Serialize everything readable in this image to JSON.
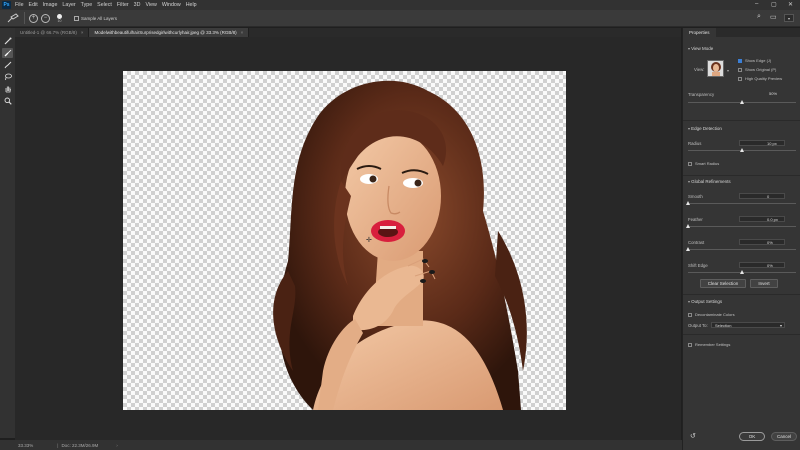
{
  "menu": [
    "File",
    "Edit",
    "Image",
    "Layer",
    "Type",
    "Select",
    "Filter",
    "3D",
    "View",
    "Window",
    "Help"
  ],
  "options": {
    "brush_size": "10",
    "sample_all_layers": "Sample All Layers"
  },
  "tabs": [
    {
      "label": "Untitled-1 @ 66.7% (RGB/8)",
      "active": false
    },
    {
      "label": "ModelwithbeautifulhairSurprisedgirlwithcurlyhair.jpeg @ 33.3% (RGB/8)",
      "active": true
    }
  ],
  "status": {
    "zoom": "33.33%",
    "doc": "Doc: 22.3M/26.9M"
  },
  "panel": {
    "tab": "Properties",
    "view_mode": {
      "title": "View Mode",
      "view_label": "View:",
      "show_edge": "Show Edge (J)",
      "show_original": "Show Original (P)",
      "high_quality_preview": "High Quality Preview"
    },
    "transparency": {
      "label": "Transparency",
      "value": "50%",
      "level": 0.5
    },
    "edge_detection": {
      "title": "Edge Detection",
      "radius_label": "Radius",
      "radius_value": "10 px",
      "radius_level": 0.5,
      "smart_radius": "Smart Radius"
    },
    "global_refinements": {
      "title": "Global Refinements",
      "smooth_label": "Smooth",
      "smooth_value": "0",
      "feather_label": "Feather",
      "feather_value": "0.0 px",
      "contrast_label": "Contrast",
      "contrast_value": "0%",
      "shift_edge_label": "Shift Edge",
      "shift_edge_value": "0%",
      "shift_level": 0.5,
      "clear_selection": "Clear Selection",
      "invert": "Invert"
    },
    "output_settings": {
      "title": "Output Settings",
      "decontaminate": "Decontaminate Colors",
      "output_to_label": "Output To:",
      "output_to_value": "Selection",
      "remember": "Remember Settings"
    },
    "ok": "OK",
    "cancel": "Cancel"
  },
  "colors": {
    "accent_red": "#e02020"
  }
}
